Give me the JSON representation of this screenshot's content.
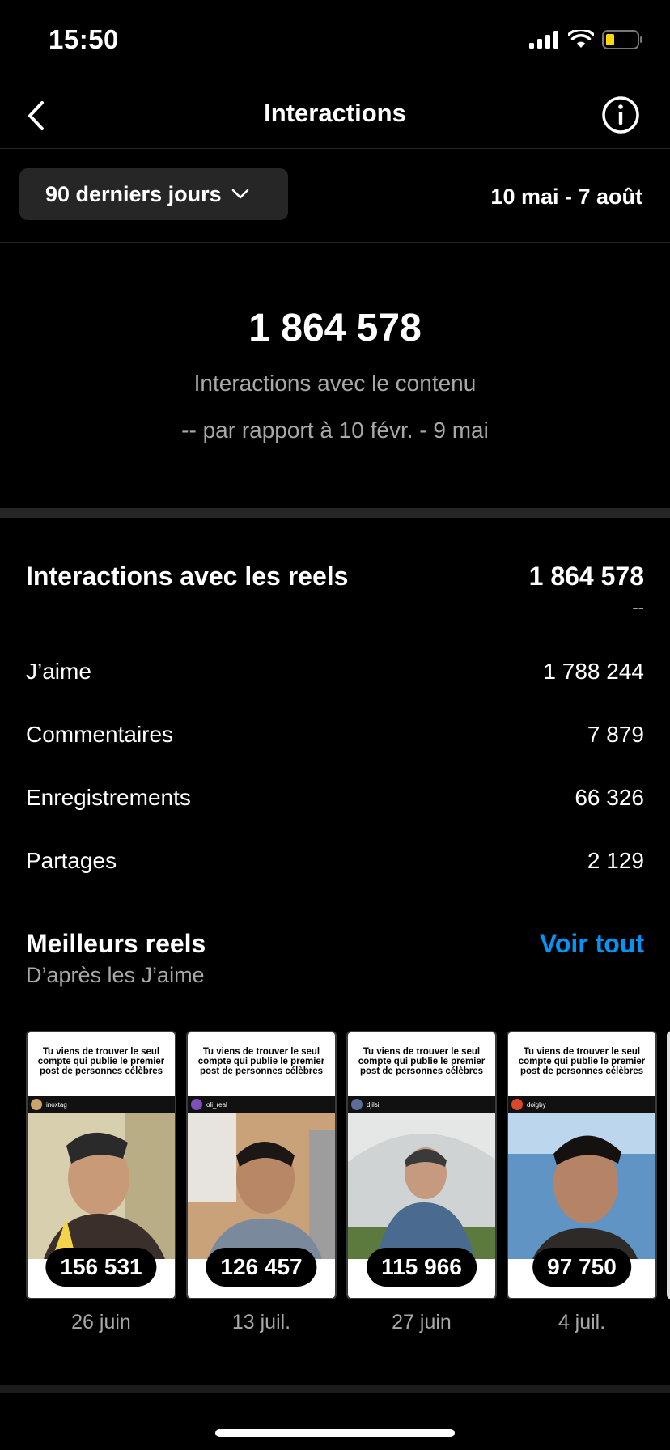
{
  "status_bar": {
    "time": "15:50"
  },
  "nav": {
    "title": "Interactions"
  },
  "filter": {
    "period": "90 derniers jours",
    "date_range": "10 mai - 7 août"
  },
  "summary": {
    "value": "1 864 578",
    "label": "Interactions avec le contenu",
    "comparison": "-- par rapport à 10 févr. - 9 mai"
  },
  "reels_interactions": {
    "title": "Interactions avec les reels",
    "total": "1 864 578",
    "delta": "--",
    "metrics": [
      {
        "label": "J’aime",
        "value": "1 788 244"
      },
      {
        "label": "Commentaires",
        "value": "7 879"
      },
      {
        "label": "Enregistrements",
        "value": "66 326"
      },
      {
        "label": "Partages",
        "value": "2 129"
      }
    ]
  },
  "best_reels": {
    "title": "Meilleurs reels",
    "subtitle": "D’après les J’aime",
    "see_all": "Voir tout",
    "items": [
      {
        "caption": "Tu viens de trouver le seul compte qui publie le premier post de personnes célèbres",
        "handle": "inoxtag",
        "count": "156 531",
        "date": "26 juin"
      },
      {
        "caption": "Tu viens de trouver le seul compte qui publie le premier post de personnes célèbres",
        "handle": "oli_real",
        "count": "126 457",
        "date": "13 juil."
      },
      {
        "caption": "Tu viens de trouver le seul compte qui publie le premier post de personnes célèbres",
        "handle": "djilsi",
        "count": "115 966",
        "date": "27 juin"
      },
      {
        "caption": "Tu viens de trouver le seul compte qui publie le premier post de personnes célèbres",
        "handle": "doigby",
        "count": "97 750",
        "date": "4 juil."
      }
    ]
  }
}
